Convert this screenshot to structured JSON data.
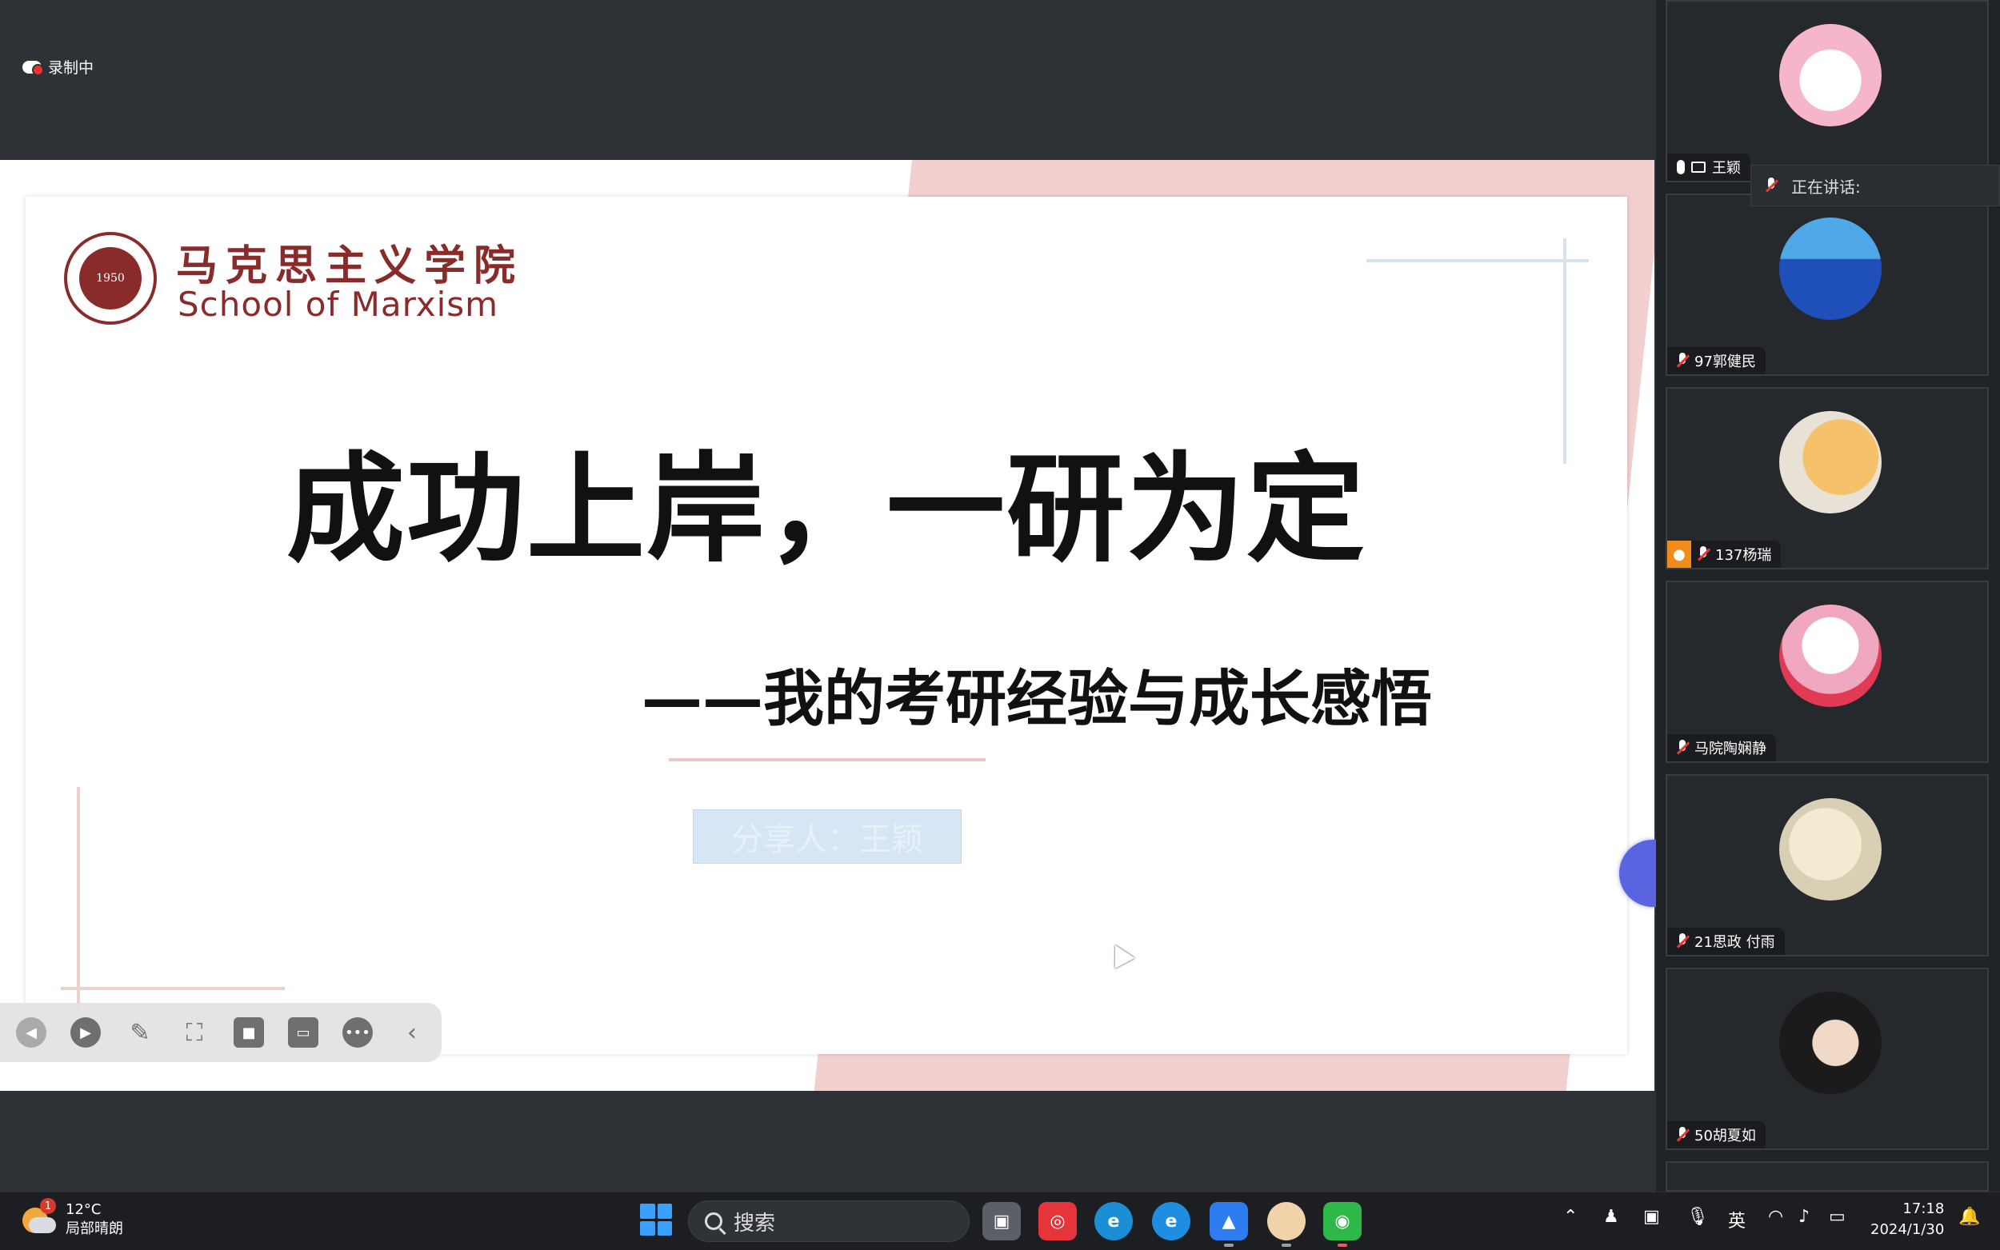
{
  "recording": {
    "label": "录制中"
  },
  "slide": {
    "brand_cn": "马克思主义学院",
    "brand_en": "School of Marxism",
    "seal_year": "1950",
    "title": "成功上岸，一研为定",
    "subtitle": "——我的考研经验与成长感悟",
    "presenter": "分享人：王颖"
  },
  "toolbar": {
    "items": [
      "prev",
      "play",
      "pen",
      "screenshot",
      "camera",
      "chat",
      "more",
      "collapse"
    ]
  },
  "speaking": {
    "label": "正在讲话:"
  },
  "participants": [
    {
      "name": "王颖",
      "mic": "on",
      "sharing": true
    },
    {
      "name": "97郭健民",
      "mic": "off"
    },
    {
      "name": "137杨瑞",
      "mic": "off",
      "host": true
    },
    {
      "name": "马院陶娴静",
      "mic": "off"
    },
    {
      "name": "21思政 付雨",
      "mic": "off"
    },
    {
      "name": "50胡夏如",
      "mic": "off"
    }
  ],
  "taskbar": {
    "weather_temp": "12°C",
    "weather_desc": "局部晴朗",
    "weather_badge": "1",
    "search_placeholder": "搜索",
    "ime": "英",
    "time": "17:18",
    "date": "2024/1/30"
  },
  "colors": {
    "brand": "#8a2b2b",
    "accent_blue": "#3aa0ff",
    "mic_muted": "#e53935"
  }
}
